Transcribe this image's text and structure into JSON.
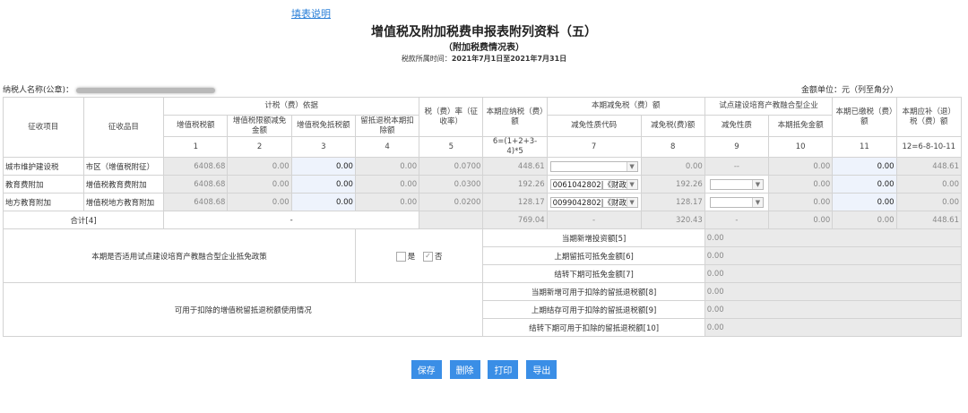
{
  "help_link": "填表说明",
  "title": "增值税及附加税费申报表附列资料（五）",
  "subtitle": "（附加税费情况表）",
  "period_label": "税款所属时间：",
  "period_value": "2021年7月1日至2021年7月31日",
  "taxpayer_label": "纳税人名称(公章)：",
  "unit_label": "金额单位：元（列至角分）",
  "headers": {
    "item": "征收项目",
    "subitem": "征收品目",
    "basis_group": "计税（费）依据",
    "c1": "增值税税额",
    "c2": "增值税限额减免金额",
    "c3": "增值税免抵税额",
    "c4": "留抵退税本期扣除额",
    "c5": "税（费）率（征收率）",
    "c6": "本期应纳税（费）额",
    "reduce_group": "本期减免税（费）额",
    "c7": "减免性质代码",
    "c8": "减免税(费)额",
    "pilot_group": "试点建设培育产教融合型企业",
    "c9": "减免性质",
    "c10": "本期抵免金额",
    "c11": "本期已缴税（费）额",
    "c12": "本期应补（退）税（费）额",
    "n1": "1",
    "n2": "2",
    "n3": "3",
    "n4": "4",
    "n5": "5",
    "n6": "6=(1+2+3-4)*5",
    "n7": "7",
    "n8": "8",
    "n9": "9",
    "n10": "10",
    "n11": "11",
    "n12": "12=6-8-10-11"
  },
  "rows": [
    {
      "item": "城市维护建设税",
      "subitem": "市区（增值税附征）",
      "c1": "6408.68",
      "c2": "0.00",
      "c3": "0.00",
      "c4": "0.00",
      "c5": "0.0700",
      "c6": "448.61",
      "c7": "",
      "c8": "0.00",
      "c9": "--",
      "c10": "0.00",
      "c11": "0.00",
      "c12": "448.61"
    },
    {
      "item": "教育费附加",
      "subitem": "增值税教育费附加",
      "c1": "6408.68",
      "c2": "0.00",
      "c3": "0.00",
      "c4": "0.00",
      "c5": "0.0300",
      "c6": "192.26",
      "c7": "0061042802|《财政部",
      "c8": "192.26",
      "c9": "",
      "c10": "0.00",
      "c11": "0.00",
      "c12": "0.00"
    },
    {
      "item": "地方教育附加",
      "subitem": "增值税地方教育附加",
      "c1": "6408.68",
      "c2": "0.00",
      "c3": "0.00",
      "c4": "0.00",
      "c5": "0.0200",
      "c6": "128.17",
      "c7": "0099042802|《财政部",
      "c8": "128.17",
      "c9": "",
      "c10": "0.00",
      "c11": "0.00",
      "c12": "0.00"
    }
  ],
  "total": {
    "label": "合计[4]",
    "basis": "-",
    "c6": "769.04",
    "c7": "-",
    "c8": "320.43",
    "c9": "-",
    "c10": "0.00",
    "c11": "0.00",
    "c12": "448.61"
  },
  "pilot_question": "本期是否适用试点建设培育产教融合型企业抵免政策",
  "yes_label": "是",
  "no_label": "否",
  "pilot_rows": [
    {
      "label": "当期新增投资额[5]",
      "value": "0.00"
    },
    {
      "label": "上期留抵可抵免金额[6]",
      "value": "0.00"
    },
    {
      "label": "结转下期可抵免金额[7]",
      "value": "0.00"
    }
  ],
  "refund_question": "可用于扣除的增值税留抵退税额使用情况",
  "refund_rows": [
    {
      "label": "当期新增可用于扣除的留抵退税额[8]",
      "value": "0.00"
    },
    {
      "label": "上期结存可用于扣除的留抵退税额[9]",
      "value": "0.00"
    },
    {
      "label": "结转下期可用于扣除的留抵退税额[10]",
      "value": "0.00"
    }
  ],
  "buttons": {
    "save": "保存",
    "delete": "删除",
    "print": "打印",
    "export": "导出"
  }
}
